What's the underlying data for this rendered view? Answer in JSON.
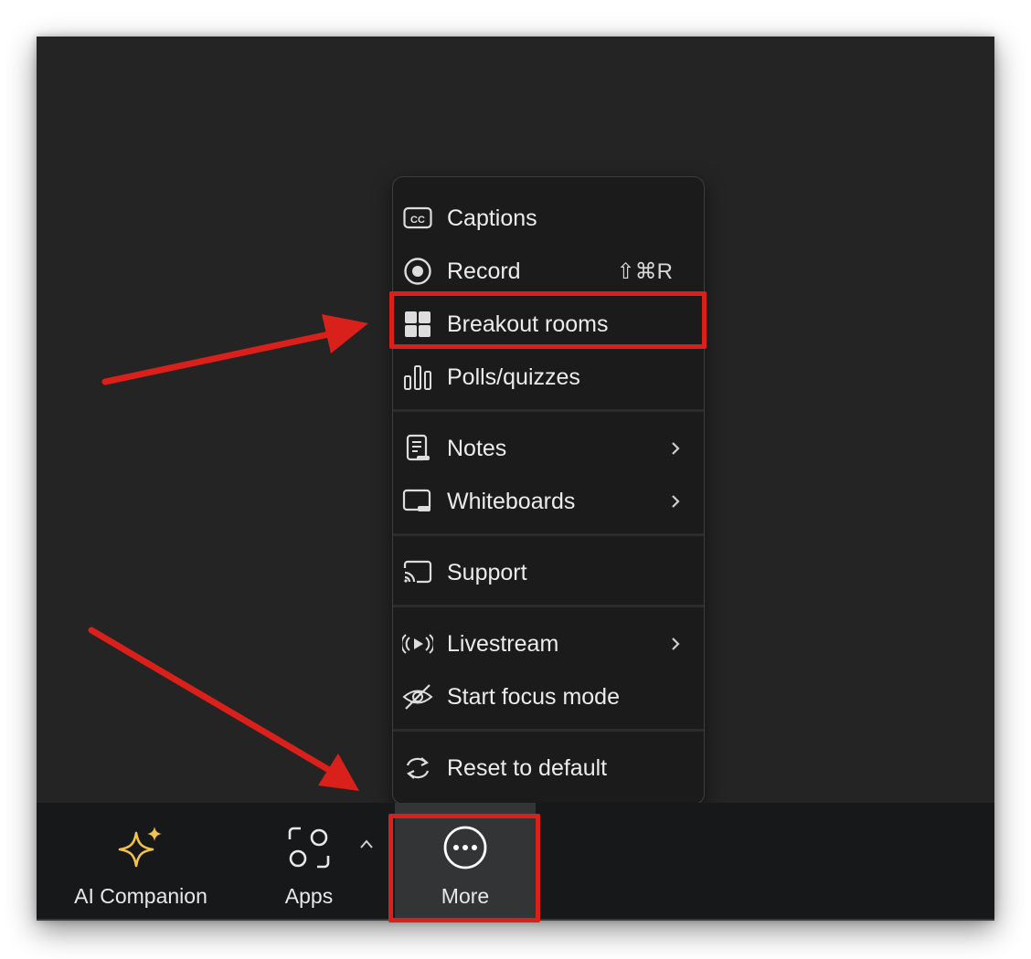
{
  "menu": {
    "items": [
      {
        "label": "Captions",
        "icon": "captions-icon"
      },
      {
        "label": "Record",
        "icon": "record-icon",
        "shortcut": "⇧⌘R"
      },
      {
        "label": "Breakout rooms",
        "icon": "breakout-rooms-icon"
      },
      {
        "label": "Polls/quizzes",
        "icon": "polls-icon"
      },
      {
        "label": "Notes",
        "icon": "notes-icon",
        "submenu": true
      },
      {
        "label": "Whiteboards",
        "icon": "whiteboard-icon",
        "submenu": true
      },
      {
        "label": "Support",
        "icon": "support-icon"
      },
      {
        "label": "Livestream",
        "icon": "livestream-icon",
        "submenu": true
      },
      {
        "label": "Start focus mode",
        "icon": "focus-mode-icon"
      },
      {
        "label": "Reset to default",
        "icon": "reset-icon"
      }
    ]
  },
  "toolbar": {
    "ai_companion_label": "AI Companion",
    "apps_label": "Apps",
    "more_label": "More"
  },
  "colors": {
    "highlight": "#d9201b",
    "ai_star": "#f2c34c",
    "window_bg": "#242424",
    "menu_bg": "#1b1b1b"
  }
}
